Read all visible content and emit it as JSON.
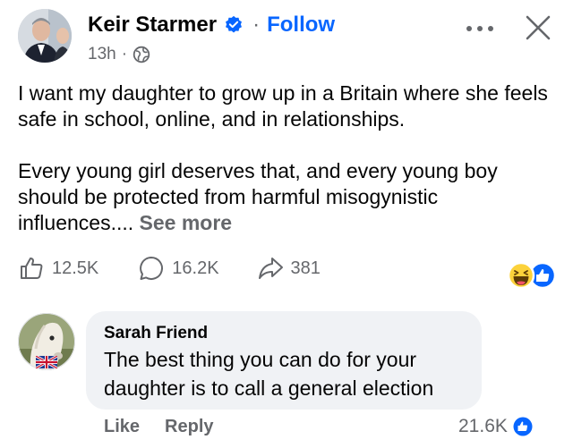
{
  "post": {
    "author": "Keir Starmer",
    "dot": "·",
    "follow": "Follow",
    "time": "13h",
    "meta_sep": "·",
    "paragraph1": "I want my daughter to grow up in a Britain where she feels safe in school, online, and in relationships.",
    "paragraph2": "Every young girl deserves that, and every young boy should be protected from harmful misogynistic influences....",
    "see_more": "See more",
    "likes": "12.5K",
    "comments": "16.2K",
    "shares": "381"
  },
  "comment": {
    "author": "Sarah Friend",
    "line1": "The best thing you can do for your",
    "line2": "daughter is to call a general election",
    "like": "Like",
    "reply": "Reply",
    "count": "21.6K"
  },
  "colors": {
    "accent": "#0866ff",
    "secondary_text": "#65676b",
    "bubble": "#f0f2f5"
  },
  "icons": [
    "verified-badge-icon",
    "globe-icon",
    "more-options-icon",
    "close-icon",
    "like-icon",
    "comment-icon",
    "share-icon",
    "haha-reaction-icon",
    "like-reaction-icon",
    "uk-flag-icon"
  ]
}
